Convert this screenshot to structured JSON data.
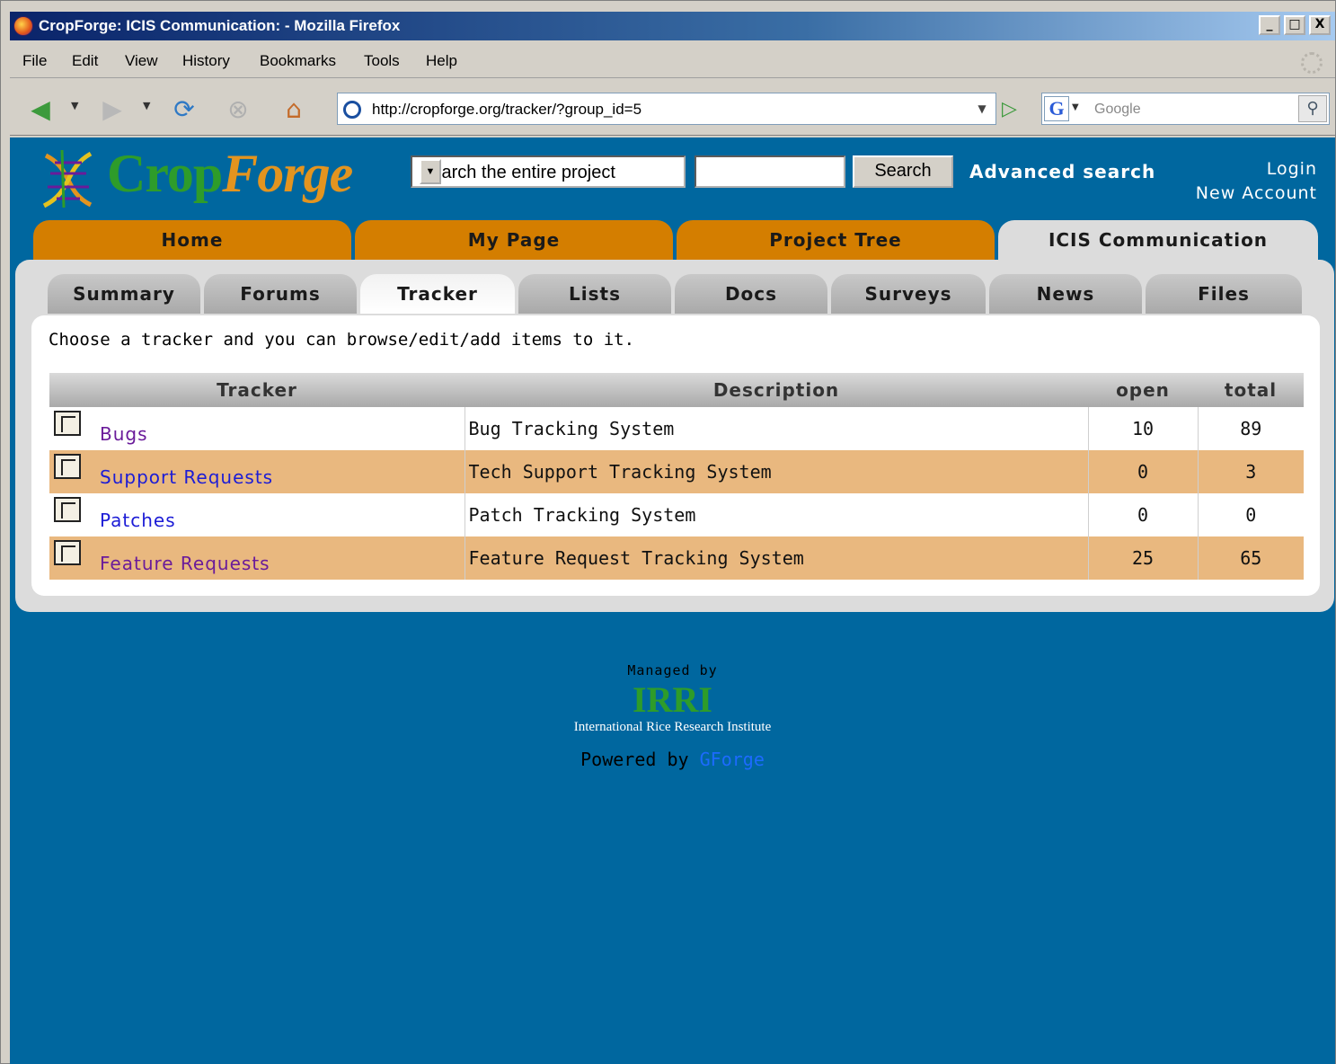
{
  "window": {
    "title": "CropForge: ICIS Communication: - Mozilla Firefox",
    "controls": [
      "_",
      "□",
      "X"
    ]
  },
  "menu": [
    "File",
    "Edit",
    "View",
    "History",
    "Bookmarks",
    "Tools",
    "Help"
  ],
  "toolbar": {
    "url": "http://cropforge.org/tracker/?group_id=5",
    "search_engine_placeholder": "Google"
  },
  "site": {
    "logo_text_1": "Crop",
    "logo_text_2": "Forge",
    "scope_selected": "Search the entire project",
    "search_label": "Search",
    "advanced_search": "Advanced search",
    "login": "Login",
    "new_account": "New Account"
  },
  "top_tabs": [
    {
      "label": "Home",
      "active": false
    },
    {
      "label": "My Page",
      "active": false
    },
    {
      "label": "Project Tree",
      "active": false
    },
    {
      "label": "ICIS Communication",
      "active": true
    }
  ],
  "sub_tabs": [
    {
      "label": "Summary",
      "active": false
    },
    {
      "label": "Forums",
      "active": false
    },
    {
      "label": "Tracker",
      "active": true
    },
    {
      "label": "Lists",
      "active": false
    },
    {
      "label": "Docs",
      "active": false
    },
    {
      "label": "Surveys",
      "active": false
    },
    {
      "label": "News",
      "active": false
    },
    {
      "label": "Files",
      "active": false
    }
  ],
  "intro": "Choose a tracker and you can browse/edit/add items to it.",
  "table": {
    "headers": [
      "Tracker",
      "Description",
      "open",
      "total"
    ],
    "rows": [
      {
        "name": "Bugs",
        "description": "Bug Tracking System",
        "open": "10",
        "total": "89",
        "visited": true
      },
      {
        "name": "Support Requests",
        "description": "Tech Support Tracking System",
        "open": "0",
        "total": "3",
        "visited": false
      },
      {
        "name": "Patches",
        "description": "Patch Tracking System",
        "open": "0",
        "total": "0",
        "visited": false
      },
      {
        "name": "Feature Requests",
        "description": "Feature Request Tracking System",
        "open": "25",
        "total": "65",
        "visited": true
      }
    ]
  },
  "footer": {
    "managed_by": "Managed by",
    "org_abbr": "IRRI",
    "org_name": "International Rice Research Institute",
    "powered_by": "Powered by",
    "powered_link": "GForge"
  },
  "colors": {
    "page_bg": "#00679f",
    "tab_orange": "#d47e00",
    "row_alt": "#e9b87f"
  }
}
